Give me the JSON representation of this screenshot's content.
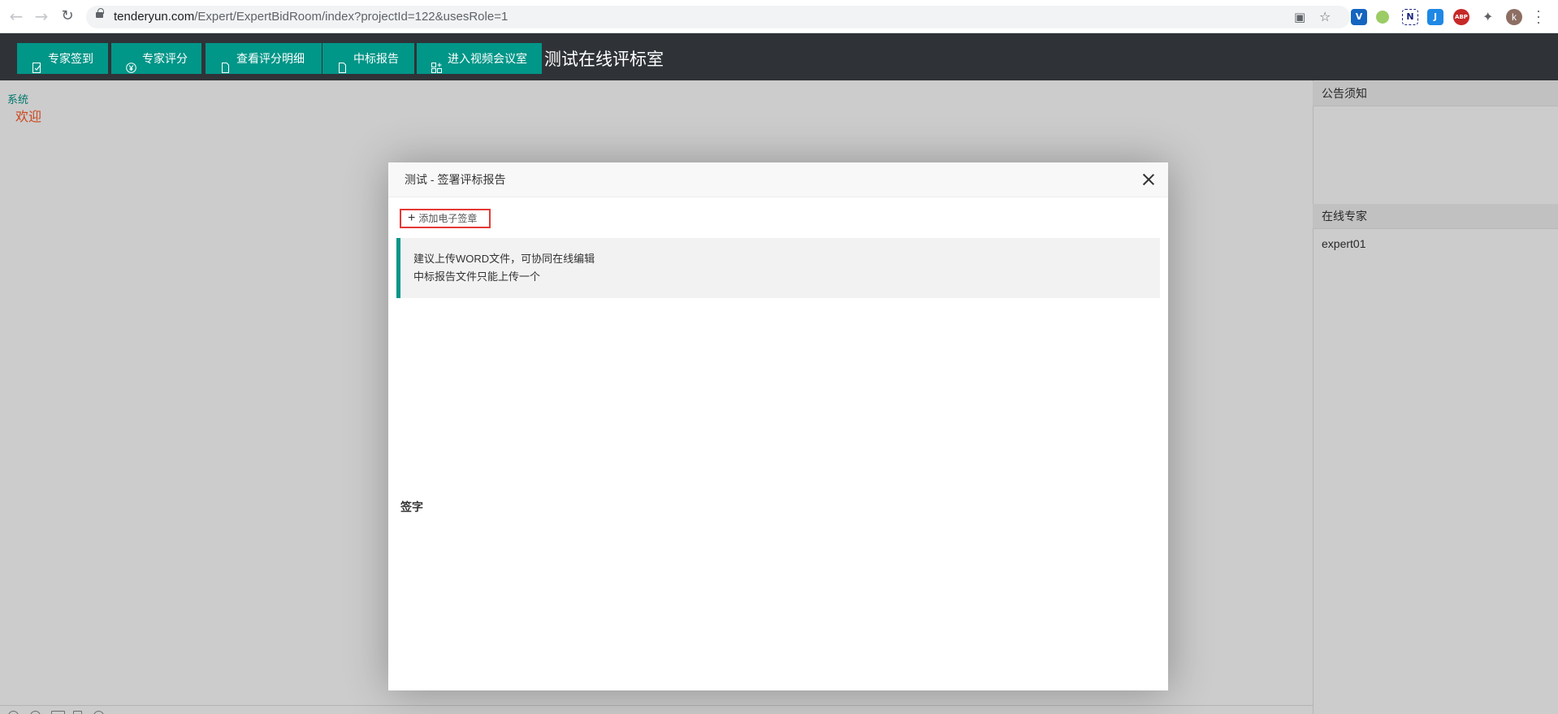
{
  "browser": {
    "url_domain": "tenderyun.com",
    "url_path": "/Expert/ExpertBidRoom/index?projectId=122&usesRole=1",
    "profile_initial": "k",
    "extensions": [
      {
        "name": "vue-devtools-extension",
        "label": "V",
        "color": "#1565c0"
      },
      {
        "name": "green-circle-extension",
        "label": "",
        "color": "#9ccc65"
      },
      {
        "name": "n-extension",
        "label": "N",
        "color": "#1a237e"
      },
      {
        "name": "j-extension",
        "label": "J",
        "color": "#1e88e5"
      },
      {
        "name": "abp-extension",
        "label": "ABP",
        "color": "#c62828"
      }
    ]
  },
  "header": {
    "buttons": [
      {
        "id": "expert-sign-in",
        "label": "专家签到",
        "icon": "sign-in-icon"
      },
      {
        "id": "expert-score",
        "label": "专家评分",
        "icon": "yen-icon"
      },
      {
        "id": "view-score-detail",
        "label": "查看评分明细",
        "icon": "document-icon"
      },
      {
        "id": "winning-bid-report",
        "label": "中标报告",
        "icon": "document-icon"
      },
      {
        "id": "enter-video-meeting",
        "label": "进入视频会议室",
        "icon": "video-room-icon"
      }
    ],
    "room_title": "测试在线评标室"
  },
  "main": {
    "system_label": "系统",
    "welcome": "欢迎"
  },
  "right_panel": {
    "notice_title": "公告须知",
    "online_title": "在线专家",
    "online_experts": [
      "expert01"
    ]
  },
  "modal": {
    "title": "测试 - 签署评标报告",
    "add_signature": "添加电子签章",
    "tips": [
      "建议上传WORD文件，可协同在线编辑",
      "中标报告文件只能上传一个"
    ],
    "signature_label": "签字"
  },
  "colors": {
    "accent": "#009688",
    "header_bg": "#2f3338",
    "welcome": "#ff5722",
    "highlight_border": "#e53935"
  }
}
